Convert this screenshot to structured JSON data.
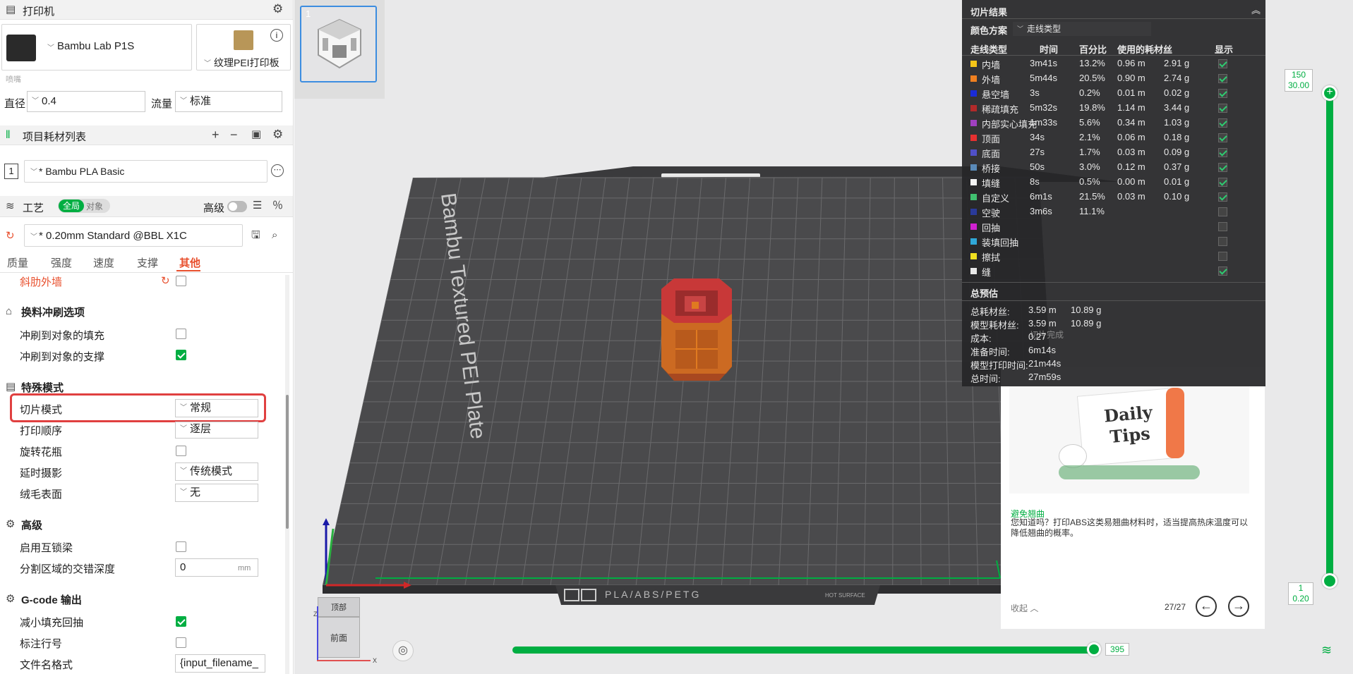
{
  "printer": {
    "section_title": "打印机",
    "name": "Bambu Lab P1S",
    "plate": "纹理PEI打印板",
    "nozzle_label": "喷嘴",
    "diameter_label": "直径",
    "diameter_value": "0.4",
    "flow_label": "流量",
    "flow_value": "标准"
  },
  "filament": {
    "section_title": "项目耗材列表",
    "index": "1",
    "name": "* Bambu PLA Basic"
  },
  "process": {
    "section_title": "工艺",
    "toggle_global": "全局",
    "toggle_object": "对象",
    "advanced_label": "高级",
    "preset": "* 0.20mm Standard @BBL X1C",
    "tabs": [
      "质量",
      "强度",
      "速度",
      "支撑",
      "其他"
    ],
    "active_tab": "其他"
  },
  "settings": {
    "slope_wall": "斜肋外墙",
    "flush_group": "换料冲刷选项",
    "flush_infill": "冲刷到对象的填充",
    "flush_support": "冲刷到对象的支撑",
    "special_group": "特殊模式",
    "slice_mode": "切片模式",
    "slice_mode_value": "常规",
    "print_seq": "打印顺序",
    "print_seq_value": "逐层",
    "spiral": "旋转花瓶",
    "timelapse": "延时摄影",
    "timelapse_value": "传统模式",
    "fuzzy": "绒毛表面",
    "fuzzy_value": "无",
    "adv_group": "高级",
    "interlock": "启用互锁梁",
    "interlock_depth": "分割区域的交错深度",
    "interlock_depth_value": "0",
    "interlock_unit": "mm",
    "gcode_group": "G-code 输出",
    "reduce_retract": "减小填充回抽",
    "line_numbers": "标注行号",
    "filename_format": "文件名格式",
    "filename_value": "{input_filename_"
  },
  "plate": {
    "label": "Bambu Textured PEI Plate",
    "bottom_label": "PLA/ABS/PETG",
    "hot_surface": "HOT SURFACE",
    "thumb_index": "1"
  },
  "axis_cube": {
    "top": "顶部",
    "front": "前面",
    "x": "X",
    "z": "Z"
  },
  "stats": {
    "title": "切片结果",
    "scheme_label": "颜色方案",
    "scheme_value": "走线类型",
    "headers": [
      "走线类型",
      "时间",
      "百分比",
      "使用的耗材丝",
      "显示"
    ],
    "rows": [
      {
        "name": "内墙",
        "time": "3m41s",
        "pct": "13.2%",
        "len": "0.96 m",
        "wt": "2.91 g",
        "color": "#f5c518",
        "on": true
      },
      {
        "name": "外墙",
        "time": "5m44s",
        "pct": "20.5%",
        "len": "0.90 m",
        "wt": "2.74 g",
        "color": "#f08020",
        "on": true
      },
      {
        "name": "悬空墙",
        "time": "3s",
        "pct": "0.2%",
        "len": "0.01 m",
        "wt": "0.02 g",
        "color": "#1a2bd8",
        "on": true
      },
      {
        "name": "稀疏填充",
        "time": "5m32s",
        "pct": "19.8%",
        "len": "1.14 m",
        "wt": "3.44 g",
        "color": "#b22a2a",
        "on": true
      },
      {
        "name": "内部实心填充",
        "time": "1m33s",
        "pct": "5.6%",
        "len": "0.34 m",
        "wt": "1.03 g",
        "color": "#a040c0",
        "on": true
      },
      {
        "name": "顶面",
        "time": "34s",
        "pct": "2.1%",
        "len": "0.06 m",
        "wt": "0.18 g",
        "color": "#e63030",
        "on": true
      },
      {
        "name": "底面",
        "time": "27s",
        "pct": "1.7%",
        "len": "0.03 m",
        "wt": "0.09 g",
        "color": "#5050c8",
        "on": true
      },
      {
        "name": "桥接",
        "time": "50s",
        "pct": "3.0%",
        "len": "0.12 m",
        "wt": "0.37 g",
        "color": "#5a8ab8",
        "on": true
      },
      {
        "name": "填缝",
        "time": "8s",
        "pct": "0.5%",
        "len": "0.00 m",
        "wt": "0.01 g",
        "color": "#f4f4f4",
        "on": true
      },
      {
        "name": "自定义",
        "time": "6m1s",
        "pct": "21.5%",
        "len": "0.03 m",
        "wt": "0.10 g",
        "color": "#40c070",
        "on": true
      },
      {
        "name": "空驶",
        "time": "3m6s",
        "pct": "11.1%",
        "len": "",
        "wt": "",
        "color": "#2a3a9a",
        "on": false
      },
      {
        "name": "回抽",
        "time": "",
        "pct": "",
        "len": "",
        "wt": "",
        "color": "#d020d0",
        "on": false
      },
      {
        "name": "装填回抽",
        "time": "",
        "pct": "",
        "len": "",
        "wt": "",
        "color": "#30a8d8",
        "on": false
      },
      {
        "name": "擦拭",
        "time": "",
        "pct": "",
        "len": "",
        "wt": "",
        "color": "#f0e020",
        "on": false
      },
      {
        "name": "缝",
        "time": "",
        "pct": "",
        "len": "",
        "wt": "",
        "color": "#e8e8e8",
        "on": true
      }
    ],
    "summary_title": "总预估",
    "summary": [
      {
        "k": "总耗材丝:",
        "v1": "3.59 m",
        "v2": "10.89 g"
      },
      {
        "k": "模型耗材丝:",
        "v1": "3.59 m",
        "v2": "10.89 g"
      },
      {
        "k": "成本:",
        "v1": "0.27",
        "v2": ""
      },
      {
        "k": "准备时间:",
        "v1": "6m14s",
        "v2": ""
      },
      {
        "k": "模型打印时间:",
        "v1": "21m44s",
        "v2": ""
      },
      {
        "k": "总时间:",
        "v1": "27m59s",
        "v2": ""
      }
    ],
    "behind_text": "切片完成"
  },
  "tips": {
    "image_title": "Daily Tips",
    "heading": "避免翘曲",
    "body": "您知道吗？打印ABS这类易翘曲材料时，适当提高热床温度可以降低翘曲的概率。",
    "collapse": "收起",
    "page": "27/27"
  },
  "layer_slider": {
    "top_layer": "150",
    "top_height": "30.00",
    "bottom_layer": "1",
    "bottom_height": "0.20"
  },
  "move_slider": {
    "value": "395"
  }
}
